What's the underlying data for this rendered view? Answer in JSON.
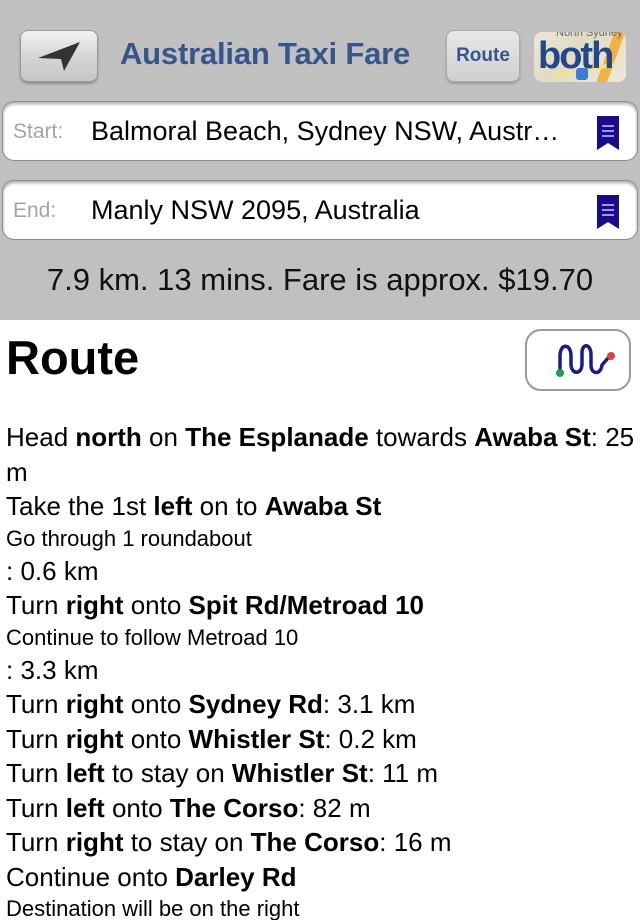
{
  "header": {
    "title": "Australian Taxi Fare",
    "route_button_label": "Route",
    "both_button_label": "both",
    "both_button_map_text": "North Sydney",
    "nav_icon": "location-arrow-icon"
  },
  "fields": {
    "start": {
      "label": "Start:",
      "value": "Balmoral Beach, Sydney NSW, Austr…",
      "icon": "bookmark-icon"
    },
    "end": {
      "label": "End:",
      "value": "Manly NSW 2095, Australia",
      "icon": "bookmark-icon"
    }
  },
  "summary": {
    "text": "7.9 km. 13 mins. Fare is approx. $19.70",
    "distance": "7.9 km",
    "duration": "13 mins",
    "fare": "$19.70"
  },
  "route": {
    "heading": "Route",
    "map_button_icon": "route-map-icon",
    "colors": {
      "route_line": "#1a1a8c",
      "start_dot": "#1aa04a",
      "end_dot": "#d94040"
    },
    "steps": [
      {
        "parts": [
          [
            "Head ",
            false
          ],
          [
            "north",
            true
          ],
          [
            " on ",
            false
          ],
          [
            "The Esplanade",
            true
          ],
          [
            " towards ",
            false
          ],
          [
            "Awaba St",
            true
          ],
          [
            ": 25 m",
            false
          ]
        ],
        "size": "normal"
      },
      {
        "parts": [
          [
            "Take the 1st ",
            false
          ],
          [
            "left",
            true
          ],
          [
            " on to ",
            false
          ],
          [
            "Awaba St",
            true
          ]
        ],
        "size": "normal"
      },
      {
        "parts": [
          [
            "Go through 1 roundabout",
            false
          ]
        ],
        "size": "small"
      },
      {
        "parts": [
          [
            ": 0.6 km",
            false
          ]
        ],
        "size": "normal"
      },
      {
        "parts": [
          [
            "Turn ",
            false
          ],
          [
            "right",
            true
          ],
          [
            " onto ",
            false
          ],
          [
            "Spit Rd/Metroad 10",
            true
          ]
        ],
        "size": "normal"
      },
      {
        "parts": [
          [
            "Continue to follow Metroad 10",
            false
          ]
        ],
        "size": "small"
      },
      {
        "parts": [
          [
            ": 3.3 km",
            false
          ]
        ],
        "size": "normal"
      },
      {
        "parts": [
          [
            "Turn ",
            false
          ],
          [
            "right",
            true
          ],
          [
            " onto ",
            false
          ],
          [
            "Sydney Rd",
            true
          ],
          [
            ": 3.1 km",
            false
          ]
        ],
        "size": "normal"
      },
      {
        "parts": [
          [
            "Turn ",
            false
          ],
          [
            "right",
            true
          ],
          [
            " onto ",
            false
          ],
          [
            "Whistler St",
            true
          ],
          [
            ": 0.2 km",
            false
          ]
        ],
        "size": "normal"
      },
      {
        "parts": [
          [
            "Turn ",
            false
          ],
          [
            "left",
            true
          ],
          [
            " to stay on ",
            false
          ],
          [
            "Whistler St",
            true
          ],
          [
            ": 11 m",
            false
          ]
        ],
        "size": "normal"
      },
      {
        "parts": [
          [
            "Turn ",
            false
          ],
          [
            "left",
            true
          ],
          [
            " onto ",
            false
          ],
          [
            "The Corso",
            true
          ],
          [
            ": 82 m",
            false
          ]
        ],
        "size": "normal"
      },
      {
        "parts": [
          [
            "Turn ",
            false
          ],
          [
            "right",
            true
          ],
          [
            " to stay on ",
            false
          ],
          [
            "The Corso",
            true
          ],
          [
            ": 16 m",
            false
          ]
        ],
        "size": "normal"
      },
      {
        "parts": [
          [
            "Continue onto ",
            false
          ],
          [
            "Darley Rd",
            true
          ]
        ],
        "size": "normal"
      },
      {
        "parts": [
          [
            "Destination will be on the right",
            false
          ]
        ],
        "size": "small"
      }
    ]
  }
}
